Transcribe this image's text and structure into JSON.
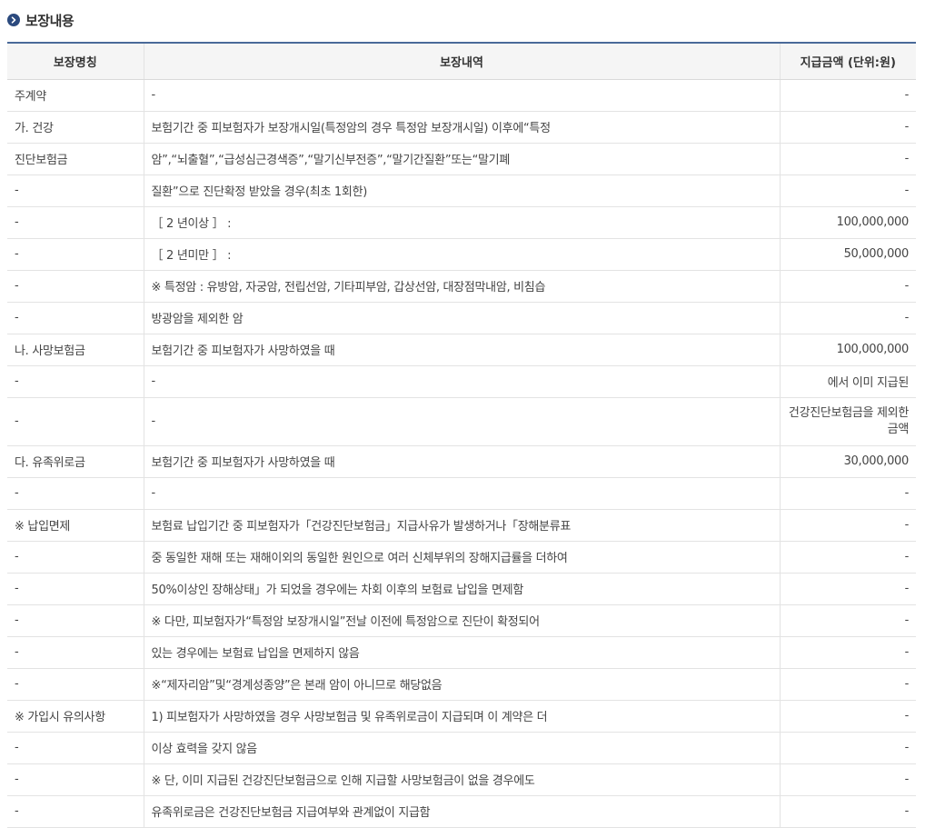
{
  "section": {
    "title": "보장내용",
    "icon": "chevron-right-circle-icon",
    "accent_color": "#2b4a7e"
  },
  "table": {
    "headers": [
      "보장명칭",
      "보장내역",
      "지급금액 (단위:원)"
    ],
    "rows": [
      {
        "name": "주계약",
        "detail": "-",
        "amount": "-"
      },
      {
        "name": "가. 건강",
        "detail": "보험기간 중 피보험자가 보장개시일(특정암의 경우 특정암 보장개시일) 이후에“특정",
        "amount": "-"
      },
      {
        "name": "진단보험금",
        "detail": "암”,“뇌출혈”,“급성심근경색증”,“말기신부전증”,“말기간질환”또는“말기폐",
        "amount": "-"
      },
      {
        "name": "-",
        "detail": "질환”으로 진단확정 받았을 경우(최초 1회한)",
        "amount": "-"
      },
      {
        "name": "-",
        "detail": "［ 2 년이상 ］ :",
        "amount": "100,000,000"
      },
      {
        "name": "-",
        "detail": "［ 2 년미만 ］ :",
        "amount": "50,000,000"
      },
      {
        "name": "-",
        "detail": "※ 특정암 : 유방암, 자궁암, 전립선암, 기타피부암, 갑상선암, 대장점막내암, 비침습",
        "amount": "-"
      },
      {
        "name": "-",
        "detail": "방광암을 제외한 암",
        "amount": "-"
      },
      {
        "name": "나. 사망보험금",
        "detail": "보험기간 중 피보험자가 사망하였을 때",
        "amount": "100,000,000"
      },
      {
        "name": "-",
        "detail": "-",
        "amount": "에서 이미 지급된"
      },
      {
        "name": "-",
        "detail": "-",
        "amount": "건강진단보험금을 제외한 금액"
      },
      {
        "name": "다. 유족위로금",
        "detail": "보험기간 중 피보험자가 사망하였을 때",
        "amount": "30,000,000"
      },
      {
        "name": "-",
        "detail": "-",
        "amount": "-"
      },
      {
        "name": "※ 납입면제",
        "detail": "보험료 납입기간 중 피보험자가「건강진단보험금」지급사유가 발생하거나「장해분류표",
        "amount": "-"
      },
      {
        "name": "-",
        "detail": "중 동일한 재해 또는 재해이외의 동일한 원인으로 여러 신체부위의 장해지급률을 더하여",
        "amount": "-"
      },
      {
        "name": "-",
        "detail": "50%이상인 장해상태」가 되었을 경우에는 차회 이후의 보험료 납입을 면제함",
        "amount": "-"
      },
      {
        "name": "-",
        "detail": "※ 다만, 피보험자가“특정암 보장개시일”전날 이전에 특정암으로 진단이 확정되어",
        "amount": "-"
      },
      {
        "name": "-",
        "detail": "있는 경우에는 보험료 납입을 면제하지 않음",
        "amount": "-"
      },
      {
        "name": "-",
        "detail": "※“제자리암”및“경계성종양”은 본래 암이 아니므로 해당없음",
        "amount": "-"
      },
      {
        "name": "※ 가입시 유의사항",
        "detail": "1) 피보험자가 사망하였을 경우 사망보험금 및 유족위로금이 지급되며 이 계약은 더",
        "amount": "-"
      },
      {
        "name": "-",
        "detail": "이상 효력을 갖지 않음",
        "amount": "-"
      },
      {
        "name": "-",
        "detail": "※ 단, 이미 지급된 건강진단보험금으로 인해 지급할 사망보험금이 없을 경우에도",
        "amount": "-"
      },
      {
        "name": "-",
        "detail": "유족위로금은 건강진단보험금 지급여부와 관계없이 지급함",
        "amount": "-"
      }
    ]
  }
}
